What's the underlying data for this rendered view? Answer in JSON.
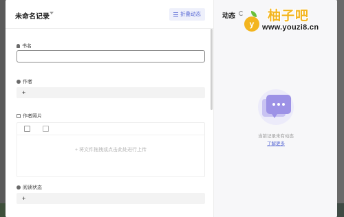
{
  "header": {
    "record_title": "未命名记录",
    "collapse_label": "折叠动态"
  },
  "form": {
    "fields": [
      {
        "label": "书名",
        "icon": "person-icon"
      },
      {
        "label": "作者",
        "icon": "circle-icon",
        "add_label": "+"
      },
      {
        "label": "作者照片",
        "icon": "image-icon"
      },
      {
        "label": "阅读状态",
        "icon": "circle-icon",
        "add_label": "+"
      }
    ],
    "upload_hint": "+ 将文件拖拽或点击此处进行上传"
  },
  "activity": {
    "title": "动态",
    "empty_text": "当前记录未有动态",
    "learn_more": "了解更多"
  },
  "watermark": {
    "initial": "y",
    "name": "柚子吧",
    "url": "www.youzi8.cn"
  },
  "colors": {
    "accent": "#5b6bd5",
    "accent_bg": "#eef0fb",
    "brand_yellow": "#f3b51f"
  }
}
